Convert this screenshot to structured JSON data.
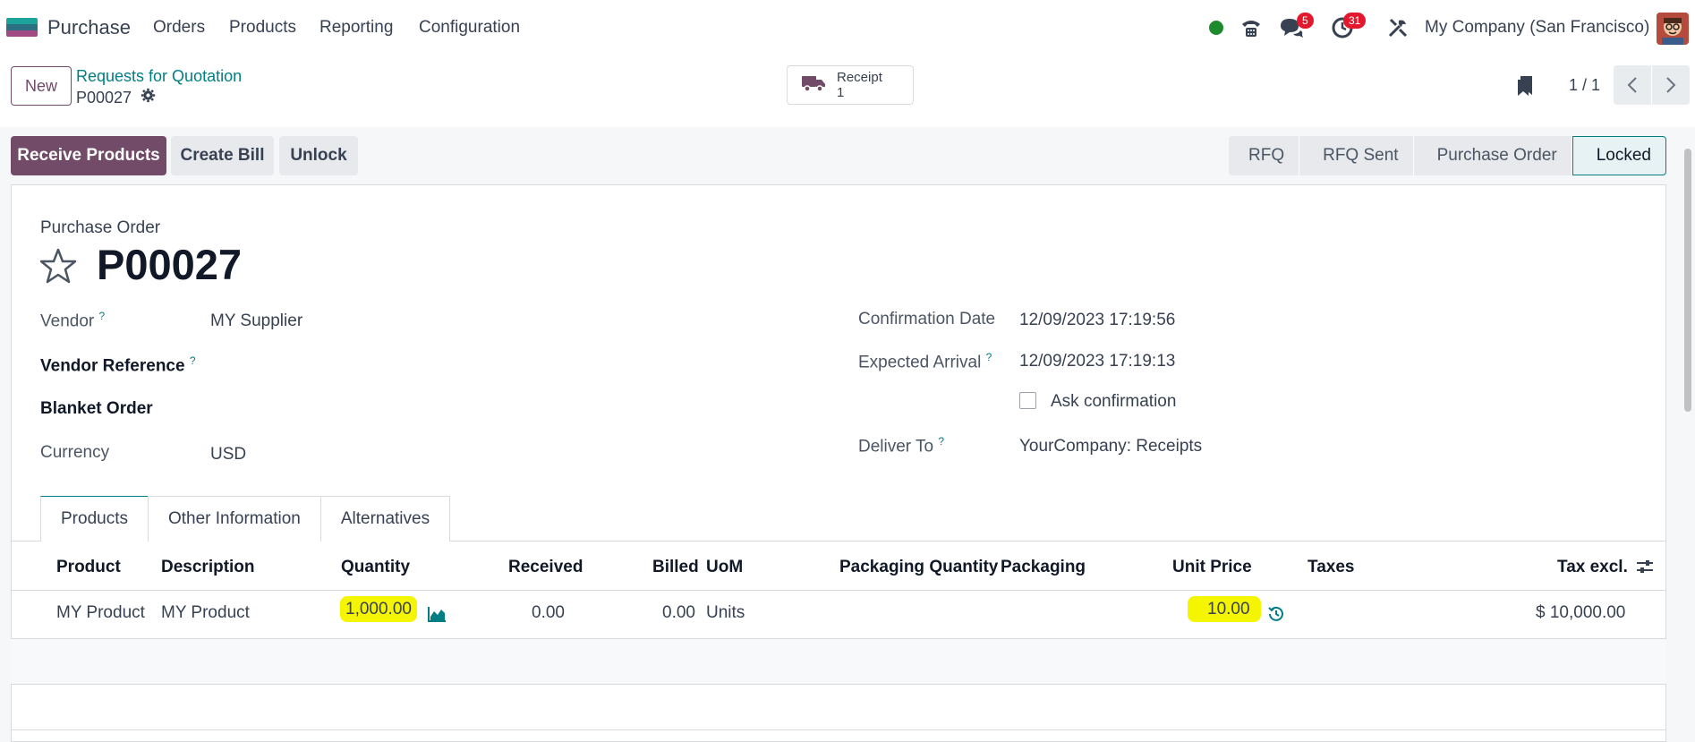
{
  "nav": {
    "brand": "Purchase",
    "menu": [
      "Orders",
      "Products",
      "Reporting",
      "Configuration"
    ],
    "messages_count": "5",
    "activities_count": "31",
    "company": "My Company (San Francisco)",
    "status_color": "#1e8a2e"
  },
  "control": {
    "new_label": "New",
    "breadcrumb": "Requests for Quotation",
    "record": "P00027",
    "smart_button": {
      "label": "Receipt",
      "count": "1"
    },
    "pager": "1 / 1"
  },
  "actions": {
    "receive": "Receive Products",
    "create_bill": "Create Bill",
    "unlock": "Unlock"
  },
  "stages": [
    "RFQ",
    "RFQ Sent",
    "Purchase Order",
    "Locked"
  ],
  "active_stage": "Locked",
  "form": {
    "title_label": "Purchase Order",
    "title": "P00027",
    "vendor_label": "Vendor",
    "vendor": "MY Supplier",
    "vendor_ref_label": "Vendor Reference",
    "blanket_label": "Blanket Order",
    "currency_label": "Currency",
    "currency": "USD",
    "confirmation_label": "Confirmation Date",
    "confirmation": "12/09/2023 17:19:56",
    "expected_label": "Expected Arrival",
    "expected": "12/09/2023 17:19:13",
    "ask_confirmation": "Ask confirmation",
    "deliver_label": "Deliver To",
    "deliver": "YourCompany: Receipts",
    "help_mark": "?"
  },
  "tabs": [
    "Products",
    "Other Information",
    "Alternatives"
  ],
  "table": {
    "headers": [
      "Product",
      "Description",
      "Quantity",
      "Received",
      "Billed",
      "UoM",
      "Packaging Quantity",
      "Packaging",
      "Unit Price",
      "Taxes",
      "Tax excl."
    ],
    "rows": [
      {
        "product": "MY Product",
        "description": "MY Product",
        "quantity": "1,000.00",
        "received": "0.00",
        "billed": "0.00",
        "uom": "Units",
        "unit_price": "10.00",
        "subtotal": "$ 10,000.00"
      }
    ]
  },
  "colors": {
    "brand": "#714b67",
    "link": "#017e84",
    "highlight": "#f5f500"
  }
}
